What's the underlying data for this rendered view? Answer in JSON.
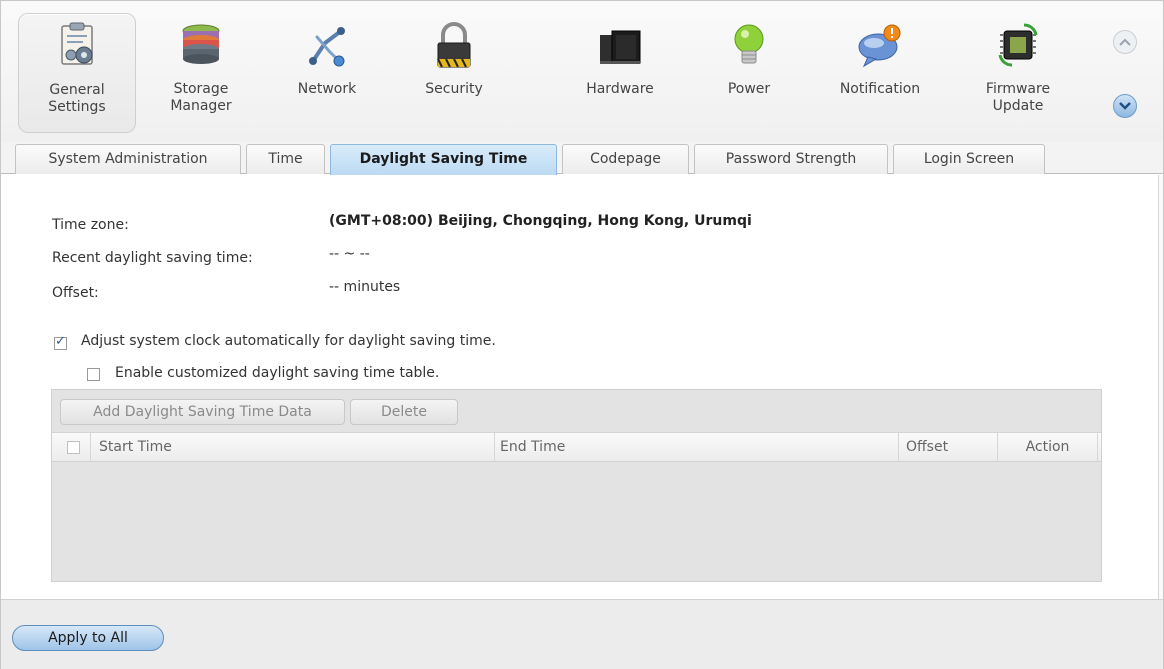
{
  "toolbar": {
    "items": [
      {
        "label": "General\nSettings",
        "icon": "general-settings-icon"
      },
      {
        "label": "Storage\nManager",
        "icon": "storage-manager-icon"
      },
      {
        "label": "Network",
        "icon": "network-icon"
      },
      {
        "label": "Security",
        "icon": "lock-icon"
      },
      {
        "label": "Hardware",
        "icon": "hardware-icon"
      },
      {
        "label": "Power",
        "icon": "lightbulb-icon"
      },
      {
        "label": "Notification",
        "icon": "notification-icon"
      },
      {
        "label": "Firmware\nUpdate",
        "icon": "firmware-update-icon"
      }
    ],
    "active": "General Settings"
  },
  "tabs": [
    {
      "label": "System Administration"
    },
    {
      "label": "Time"
    },
    {
      "label": "Daylight Saving Time"
    },
    {
      "label": "Codepage"
    },
    {
      "label": "Password Strength"
    },
    {
      "label": "Login Screen"
    }
  ],
  "active_tab": "Daylight Saving Time",
  "fields": {
    "timezone_label": "Time zone:",
    "timezone_value": "(GMT+08:00) Beijing, Chongqing, Hong Kong, Urumqi",
    "recent_label": "Recent daylight saving time:",
    "recent_value": "-- ~ --",
    "offset_label": "Offset:",
    "offset_value": "-- minutes"
  },
  "options": {
    "adjust_clock_label": "Adjust system clock automatically for daylight saving time.",
    "adjust_clock_checked": true,
    "custom_table_label": "Enable customized daylight saving time table.",
    "custom_table_checked": false
  },
  "grid": {
    "add_button": "Add Daylight Saving Time Data",
    "delete_button": "Delete",
    "columns": [
      "Start Time",
      "End Time",
      "Offset",
      "Action"
    ],
    "rows": []
  },
  "footer": {
    "apply_label": "Apply to All"
  },
  "colors": {
    "active_tab": "#bcdaf3",
    "apply_button": "#9fc4e8"
  }
}
